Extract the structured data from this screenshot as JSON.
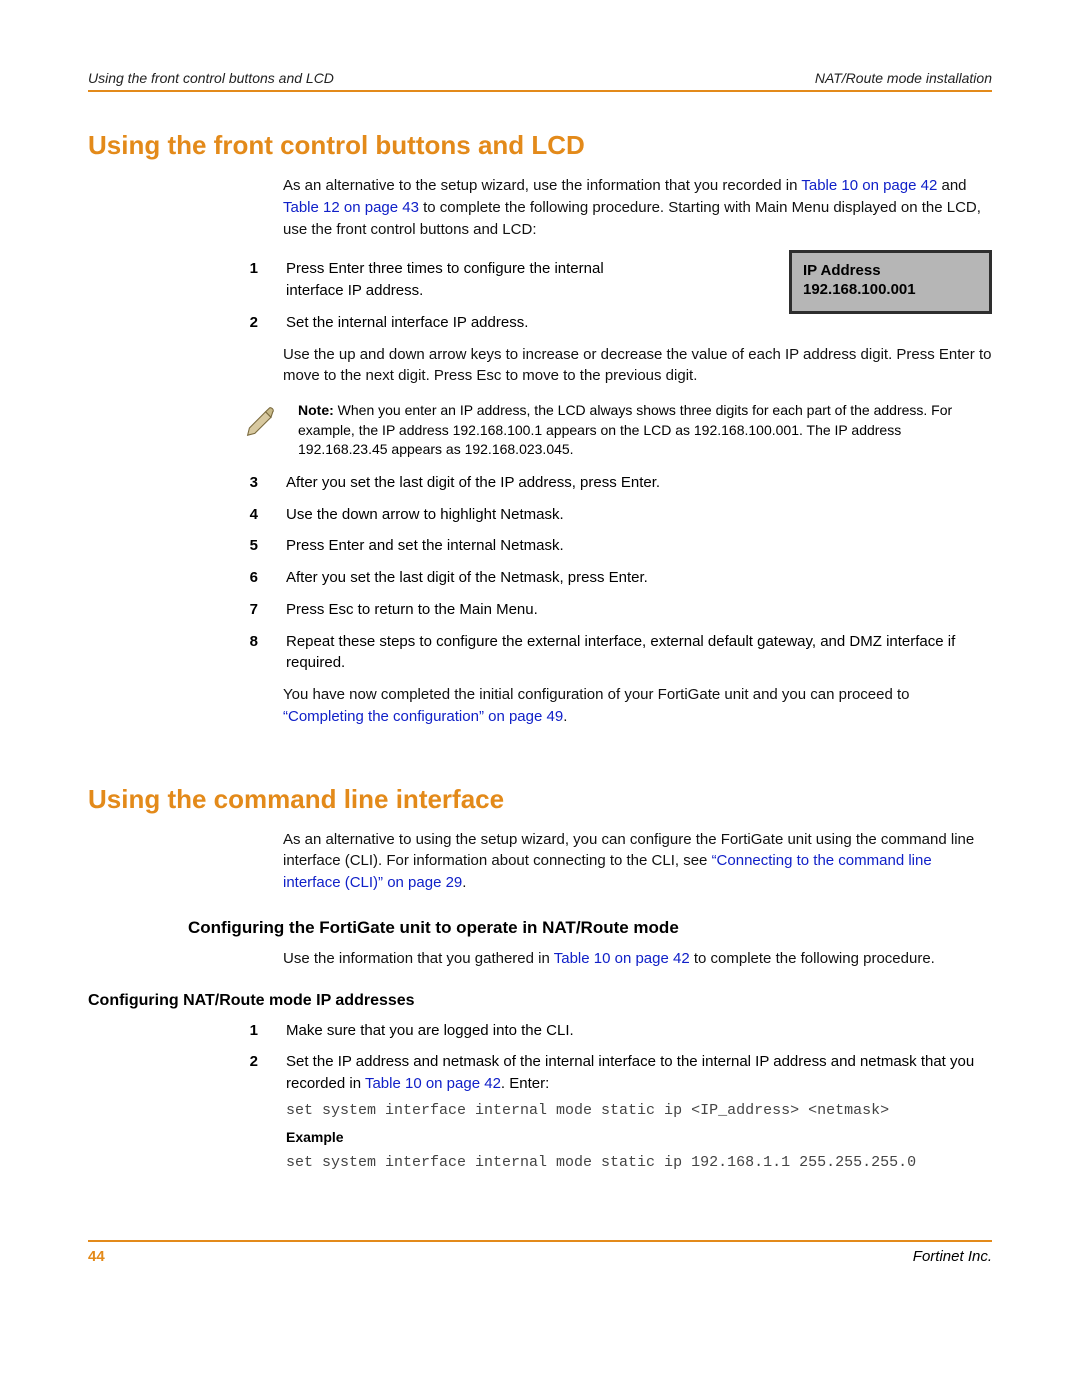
{
  "header": {
    "left": "Using the front control buttons and LCD",
    "right": "NAT/Route mode installation"
  },
  "section1": {
    "title": "Using the front control buttons and LCD",
    "intro_pre": "As an alternative to the setup wizard, use the information that you recorded in ",
    "link1": "Table 10 on page 42",
    "intro_mid": " and ",
    "link2": "Table 12 on page 43",
    "intro_post": " to complete the following procedure. Starting with Main Menu displayed on the LCD, use the front control buttons and LCD:",
    "steps_a": [
      {
        "n": "1",
        "t": "Press Enter three times to configure the internal interface IP address."
      },
      {
        "n": "2",
        "t": "Set the internal interface IP address."
      }
    ],
    "lcd": {
      "line1": "IP Address",
      "line2": "192.168.100.001"
    },
    "after2": "Use the up and down arrow keys to increase or decrease the value of each IP address digit. Press Enter to move to the next digit. Press Esc to move to the previous digit.",
    "note_label": "Note:",
    "note_body": " When you enter an IP address, the LCD always shows three digits for each part of the address. For example, the IP address 192.168.100.1 appears on the LCD as 192.168.100.001. The IP address 192.168.23.45 appears as 192.168.023.045.",
    "steps_b": [
      {
        "n": "3",
        "t": "After you set the last digit of the IP address, press Enter."
      },
      {
        "n": "4",
        "t": "Use the down arrow to highlight Netmask."
      },
      {
        "n": "5",
        "t": "Press Enter and set the internal Netmask."
      },
      {
        "n": "6",
        "t": "After you set the last digit of the Netmask, press Enter."
      },
      {
        "n": "7",
        "t": "Press Esc to return to the Main Menu."
      },
      {
        "n": "8",
        "t": "Repeat these steps to configure the external interface, external default gateway, and DMZ interface if required."
      }
    ],
    "closing_pre": "You have now completed the initial configuration of your FortiGate unit and you can proceed to ",
    "closing_link": "“Completing the configuration” on page 49",
    "closing_post": "."
  },
  "section2": {
    "title": "Using the command line interface",
    "intro_pre": "As an alternative to using the setup wizard, you can configure the FortiGate unit using the command line interface (CLI). For information about connecting to the CLI, see ",
    "intro_link": "“Connecting to the command line interface (CLI)” on page 29",
    "intro_post": ".",
    "h3": "Configuring the FortiGate unit to operate in NAT/Route mode",
    "h3_para_pre": "Use the information that you gathered in ",
    "h3_para_link": "Table 10 on page 42",
    "h3_para_post": " to complete the following procedure.",
    "h4": "Configuring NAT/Route mode IP addresses",
    "steps": [
      {
        "n": "1",
        "t": "Make sure that you are logged into the CLI."
      },
      {
        "n": "2",
        "t_pre": "Set the IP address and netmask of the internal interface to the internal IP address and netmask that you recorded in ",
        "t_link": "Table 10 on page 42",
        "t_post": ". Enter:"
      }
    ],
    "code1": "set system interface internal mode static ip <IP_address> <netmask>",
    "example_label": "Example",
    "code2": "set system interface internal mode static ip 192.168.1.1 255.255.255.0"
  },
  "footer": {
    "page": "44",
    "brand": "Fortinet Inc."
  }
}
